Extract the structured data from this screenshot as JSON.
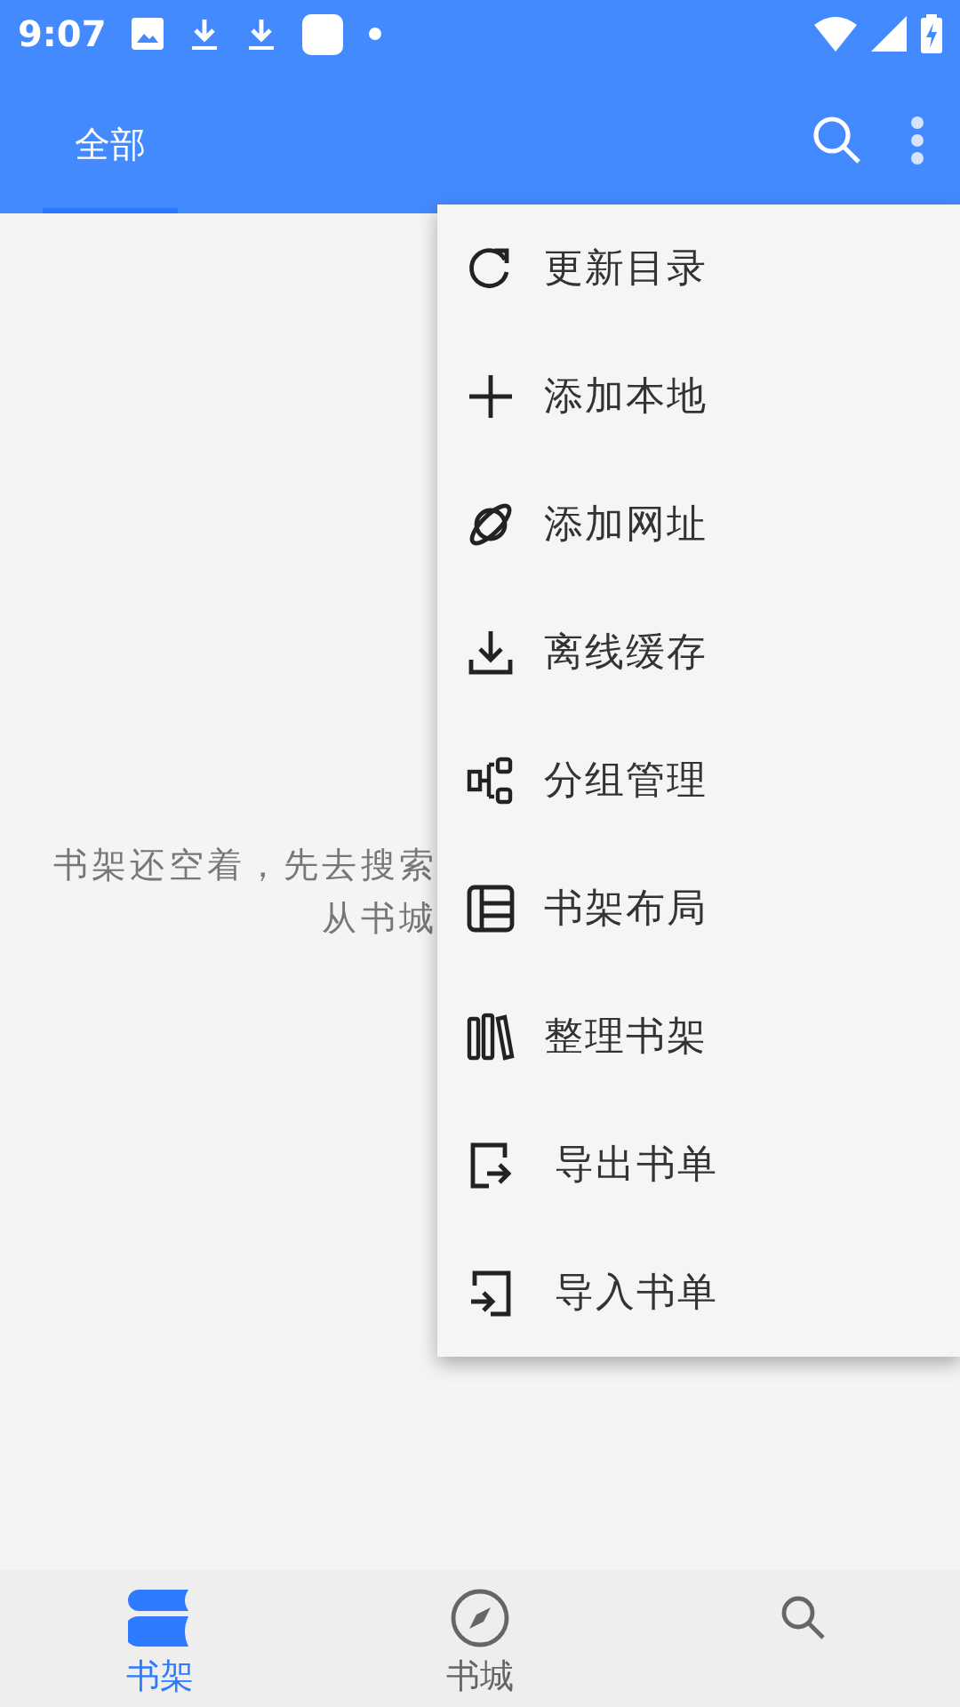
{
  "status_bar": {
    "time": "9:07"
  },
  "app_bar": {
    "tabs": [
      {
        "label": "全部",
        "selected": true
      }
    ]
  },
  "empty_message": {
    "lines": [
      "书架还空着，先去搜索",
      "从书城"
    ]
  },
  "menu": {
    "items": [
      {
        "label": "更新目录",
        "kind": "refresh"
      },
      {
        "label": "添加本地",
        "kind": "plus"
      },
      {
        "label": "添加网址",
        "kind": "planet"
      },
      {
        "label": "离线缓存",
        "kind": "download"
      },
      {
        "label": "分组管理",
        "kind": "group"
      },
      {
        "label": "书架布局",
        "kind": "layout"
      },
      {
        "label": "整理书架",
        "kind": "books"
      },
      {
        "label": "导出书单",
        "kind": "export"
      },
      {
        "label": "导入书单",
        "kind": "import"
      }
    ]
  },
  "bottom_nav": {
    "items": [
      {
        "label": "书架",
        "kind": "shelf",
        "selected": true
      },
      {
        "label": "书城",
        "kind": "compass",
        "selected": false
      },
      {
        "kind": "search",
        "selected": false
      }
    ]
  }
}
